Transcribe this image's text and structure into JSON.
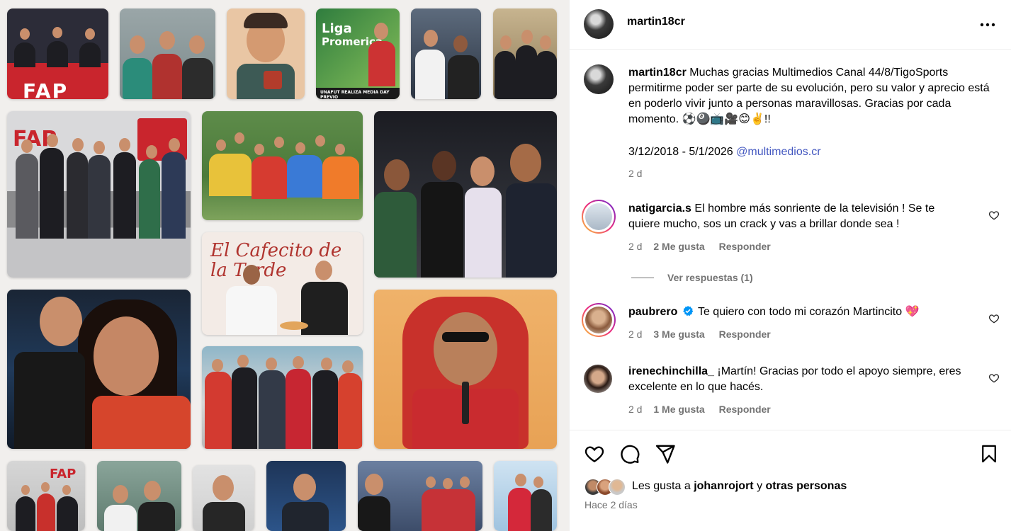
{
  "post": {
    "author": "martin18cr",
    "caption": {
      "username": "martin18cr",
      "text": "Muchas gracias Multimedios Canal 44/8/TigoSports permitirme poder ser parte de su evolución, pero su valor y aprecio está en poderlo vivir junto a personas maravillosas. Gracias por cada momento. ⚽🎱📺🎥😊✌️!!",
      "dates": "3/12/2018 - 5/1/2026",
      "mention": "@multimedios.cr",
      "time": "2 d"
    },
    "comments": [
      {
        "username": "natigarcia.s",
        "text": "El hombre más sonriente de la televisión ! Se te quiere mucho, sos un crack y vas a brillar donde sea !",
        "time": "2 d",
        "likes": "2 Me gusta",
        "reply": "Responder",
        "view_replies": "Ver respuestas (1)"
      },
      {
        "username": "paubrero",
        "verified": "verified-badge-icon",
        "text": "Te quiero con todo mi corazón Martincito 💖",
        "time": "2 d",
        "likes": "3 Me gusta",
        "reply": "Responder"
      },
      {
        "username": "irenechinchilla_",
        "text": "¡Martín! Gracias por todo el apoyo siempre, eres excelente en lo que hacés.",
        "time": "2 d",
        "likes": "1 Me gusta",
        "reply": "Responder"
      }
    ],
    "likes_line": {
      "prefix": "Les gusta a",
      "user": "johanrojort",
      "joiner": "y",
      "others": "otras personas"
    },
    "date_ago": "Hace 2 días"
  },
  "media": {
    "banners": {
      "fap": "FAP",
      "liga_line1": "Liga",
      "liga_line2": "Promerica",
      "cafecito": "El Cafecito de la Tarde",
      "unafut": "UNAFUT REALIZA MEDIA DAY PREVIO"
    }
  },
  "icons": {
    "more": "more-horizontal-icon",
    "like": "heart-icon",
    "comment": "comment-icon",
    "share": "paper-plane-icon",
    "save": "bookmark-icon"
  },
  "colors": {
    "link": "#4357c0",
    "muted": "#737373",
    "verified": "#0095f6"
  }
}
